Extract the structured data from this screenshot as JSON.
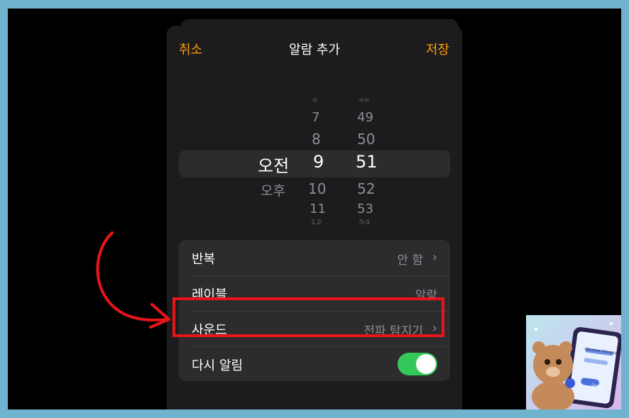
{
  "nav": {
    "cancel": "취소",
    "title": "알람 추가",
    "save": "저장"
  },
  "picker": {
    "ampm": [
      "오전",
      "오후"
    ],
    "hours": [
      "6",
      "7",
      "8",
      "9",
      "10",
      "11",
      "12"
    ],
    "minutes": [
      "48",
      "49",
      "50",
      "51",
      "52",
      "53",
      "54"
    ],
    "selected": {
      "ampm": "오전",
      "hour": "9",
      "minute": "51"
    }
  },
  "settings": [
    {
      "label": "반복",
      "value": "안 함",
      "chevron": true
    },
    {
      "label": "레이블",
      "value": "알람",
      "chevron": false
    },
    {
      "label": "사운드",
      "value": "전파 탐지기",
      "chevron": true
    },
    {
      "label": "다시 알림",
      "toggle": true
    }
  ],
  "thumbnail": {
    "caption": "Vibration Intensity",
    "button": "Google"
  },
  "colors": {
    "accent": "#ff9f0a",
    "toggle_on": "#34c759",
    "highlight": "#e8141a",
    "border": "#6fb3cf"
  }
}
